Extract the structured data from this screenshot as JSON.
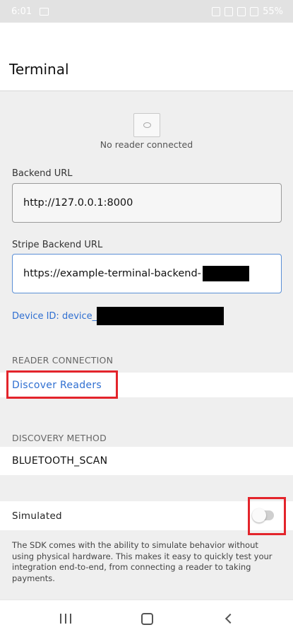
{
  "status_bar": {
    "time": "6:01",
    "battery": "55%"
  },
  "app_bar": {
    "title": "Terminal"
  },
  "reader_status": {
    "icon": "card-reader-icon",
    "text": "No reader connected"
  },
  "backend_url": {
    "label": "Backend URL",
    "value": "http://127.0.0.1:8000"
  },
  "stripe_backend_url": {
    "label": "Stripe Backend URL",
    "value": "https://example-terminal-backend-"
  },
  "device_id": {
    "text": "Device ID: device_"
  },
  "reader_connection": {
    "header": "READER CONNECTION",
    "discover_label": "Discover Readers"
  },
  "discovery_method": {
    "header": "DISCOVERY METHOD",
    "value": "BLUETOOTH_SCAN"
  },
  "simulated": {
    "label": "Simulated",
    "enabled": false,
    "description": "The SDK comes with the ability to simulate behavior without using physical hardware. This makes it easy to quickly test your integration end-to-end, from connecting a reader to taking payments."
  },
  "colors": {
    "accent": "#2f6fd1",
    "highlight": "#e3242b",
    "background": "#efefef"
  },
  "nav_bar": {
    "icons": [
      "recent-apps-icon",
      "home-icon",
      "back-icon"
    ]
  }
}
